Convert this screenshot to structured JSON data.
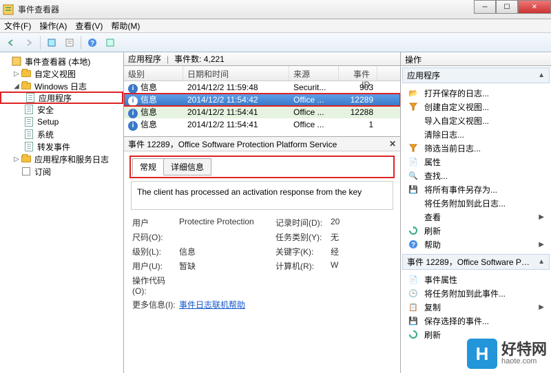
{
  "window": {
    "title": "事件查看器"
  },
  "menu": {
    "file": "文件(F)",
    "action": "操作(A)",
    "view": "查看(V)",
    "help": "帮助(M)"
  },
  "tree": {
    "root": "事件查看器 (本地)",
    "custom": "自定义视图",
    "winlogs": "Windows 日志",
    "app": "应用程序",
    "security": "安全",
    "setup": "Setup",
    "system": "系统",
    "forward": "转发事件",
    "svcapps": "应用程序和服务日志",
    "subs": "订阅"
  },
  "grid": {
    "title_left": "应用程序",
    "title_right": "事件数: 4,221",
    "cols": {
      "level": "级别",
      "datetime": "日期和时间",
      "source": "来源",
      "eventid": "事件 ID"
    },
    "rows": [
      {
        "level": "信息",
        "dt": "2014/12/2 11:59:48",
        "src": "Securit...",
        "id": "903"
      },
      {
        "level": "信息",
        "dt": "2014/12/2 11:54:42",
        "src": "Office ...",
        "id": "12289"
      },
      {
        "level": "信息",
        "dt": "2014/12/2 11:54:41",
        "src": "Office ...",
        "id": "12288"
      },
      {
        "level": "信息",
        "dt": "2014/12/2 11:54:41",
        "src": "Office ...",
        "id": "1"
      }
    ]
  },
  "detail": {
    "header": "事件 12289，Office Software Protection Platform Service",
    "tabs": {
      "general": "常规",
      "details": "详细信息"
    },
    "desc": "The client has processed an activation response from the key",
    "fields": {
      "user_lbl": "用户",
      "user_val": "Protectire Protection",
      "logtime_lbl": "记录时间(D):",
      "logtime_val": "20",
      "kcode_lbl": "尺码(O):",
      "kcode_val": "",
      "taskcat_lbl": "任务类别(Y):",
      "taskcat_val": "无",
      "level_lbl": "级别(L):",
      "level_val": "信息",
      "keyword_lbl": "关键字(K):",
      "keyword_val": "经",
      "user2_lbl": "用户(U):",
      "user2_val": "暂缺",
      "computer_lbl": "计算机(R):",
      "computer_val": "W",
      "opcode_lbl": "操作代码(O):",
      "moreinfo_lbl": "更多信息(I):",
      "helplink": "事件日志联机帮助"
    }
  },
  "actions": {
    "header": "操作",
    "sec1": "应用程序",
    "items1": [
      "打开保存的日志...",
      "创建自定义视图...",
      "导入自定义视图...",
      "清除日志...",
      "筛选当前日志...",
      "属性",
      "查找...",
      "将所有事件另存为...",
      "将任务附加到此日志...",
      "查看",
      "刷新",
      "帮助"
    ],
    "sec2": "事件 12289，Office Software Prot...",
    "items2": [
      "事件属性",
      "将任务附加到此事件...",
      "复制",
      "保存选择的事件...",
      "刷新"
    ]
  },
  "watermark": {
    "badge": "H",
    "line1": "好特网",
    "line2": "haote.com"
  }
}
